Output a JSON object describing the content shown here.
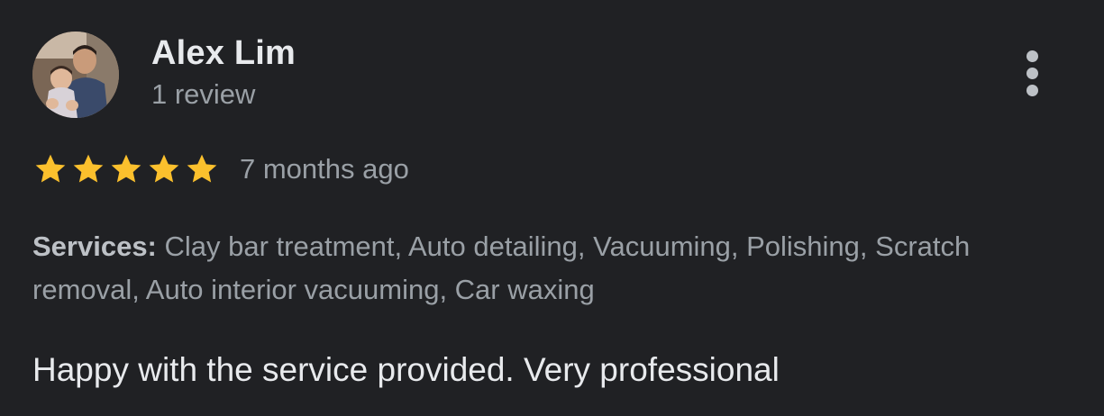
{
  "review": {
    "author_name": "Alex Lim",
    "review_count": "1 review",
    "rating": 5,
    "max_rating": 5,
    "date": "7 months ago",
    "services_label": "Services:",
    "services_list": "Clay bar treatment, Auto detailing, Vacuuming, Polishing, Scratch removal, Auto interior vacuuming, Car waxing",
    "text": "Happy with the service provided. Very professional"
  },
  "icons": {
    "avatar": "profile-photo",
    "menu": "more-vert-icon",
    "star": "star-icon"
  },
  "colors": {
    "background": "#202124",
    "primary_text": "#e8eaed",
    "secondary_text": "#9aa0a6",
    "star": "#fbc02d"
  }
}
